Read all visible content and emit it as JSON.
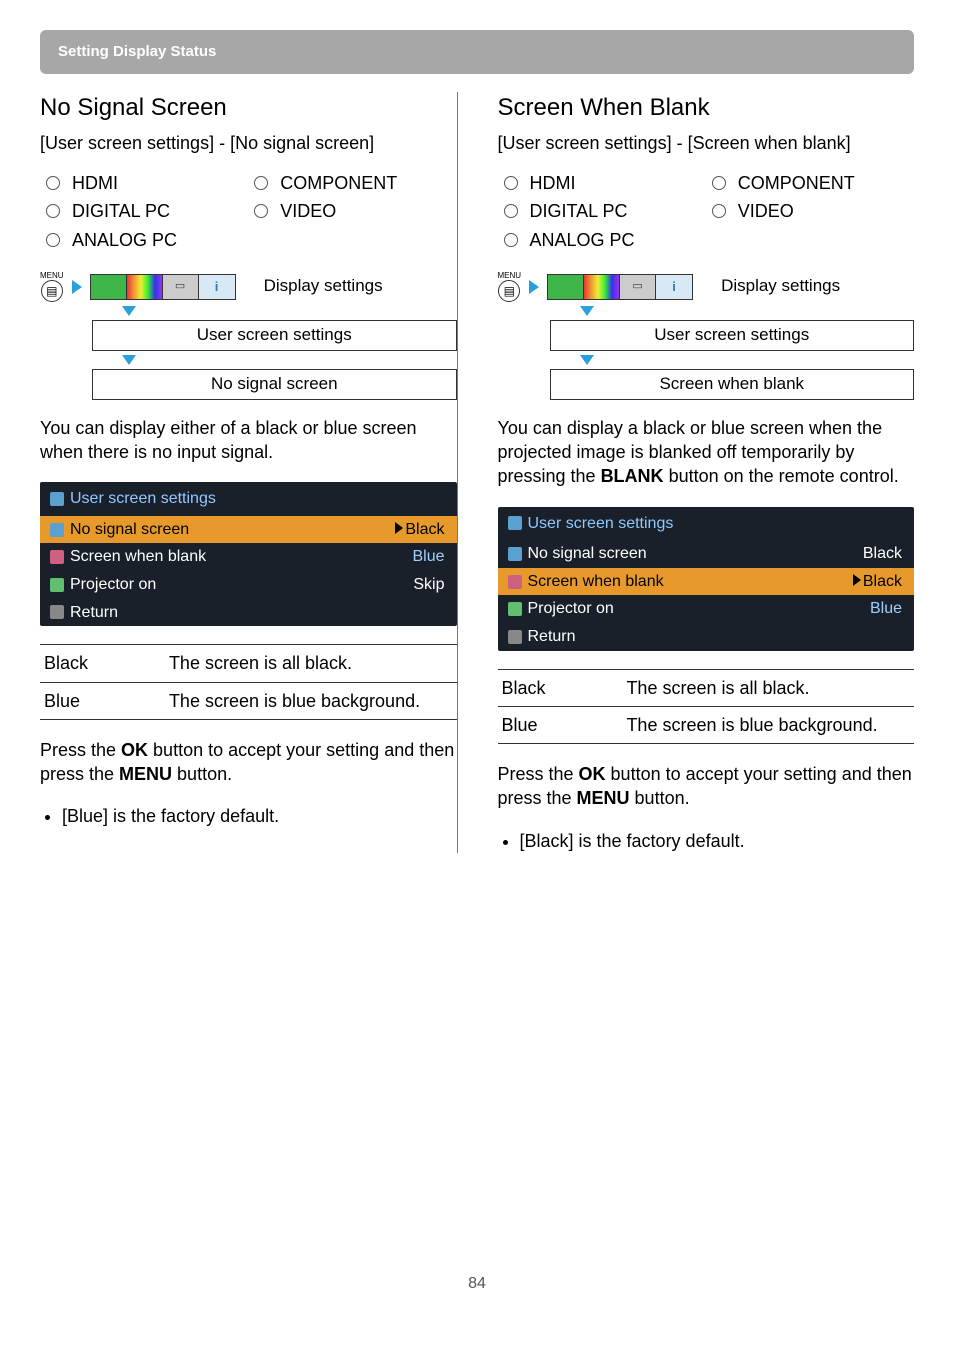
{
  "header": "Setting Display Status",
  "page_number": "84",
  "inputs": [
    "HDMI",
    "COMPONENT",
    "DIGITAL PC",
    "VIDEO",
    "ANALOG PC"
  ],
  "nav": {
    "menu_word": "MENU",
    "display_settings": "Display settings",
    "user_screen_settings": "User screen settings",
    "info_glyph": "i",
    "proj_glyph": "▭"
  },
  "left": {
    "title": "No Signal Screen",
    "breadcrumb": "[User screen settings] - [No signal screen]",
    "nav_leaf": "No signal screen",
    "desc": "You can display either of a black or blue screen when there is no input signal.",
    "osd": {
      "title": "User screen settings",
      "rows": [
        {
          "name": "No signal screen",
          "value": "Black",
          "highlight": true,
          "arrow": true,
          "value_color": "black",
          "icon": "blue"
        },
        {
          "name": "Screen when blank",
          "value": "Blue",
          "highlight": false,
          "arrow": false,
          "value_color": "blue",
          "icon": "pink"
        },
        {
          "name": "Projector on",
          "value": "Skip",
          "highlight": false,
          "arrow": false,
          "value_color": "white",
          "icon": "green"
        },
        {
          "name": "Return",
          "value": "",
          "highlight": false,
          "arrow": false,
          "value_color": "",
          "icon": "grey"
        }
      ]
    },
    "options": [
      {
        "k": "Black",
        "v": "The screen is all black."
      },
      {
        "k": "Blue",
        "v": "The screen is blue background."
      }
    ],
    "accept_pre": "Press the ",
    "accept_ok": "OK",
    "accept_mid": " button to accept your setting and then press the ",
    "accept_menu": "MENU",
    "accept_post": " button.",
    "note": "[Blue] is the factory default."
  },
  "right": {
    "title": "Screen When Blank",
    "breadcrumb": "[User screen settings] - [Screen when blank]",
    "nav_leaf": "Screen when blank",
    "desc_pre": "You can display a black or blue screen when the projected image is blanked off temporarily by pressing the ",
    "desc_kw": "BLANK",
    "desc_post": " button on the remote control.",
    "osd": {
      "title": "User screen settings",
      "rows": [
        {
          "name": "No signal screen",
          "value": "Black",
          "highlight": false,
          "arrow": false,
          "value_color": "white",
          "icon": "blue"
        },
        {
          "name": "Screen when blank",
          "value": "Black",
          "highlight": true,
          "arrow": true,
          "value_color": "black",
          "icon": "pink"
        },
        {
          "name": "Projector on",
          "value": "Blue",
          "highlight": false,
          "arrow": false,
          "value_color": "blue",
          "icon": "green"
        },
        {
          "name": "Return",
          "value": "",
          "highlight": false,
          "arrow": false,
          "value_color": "",
          "icon": "grey"
        }
      ]
    },
    "options": [
      {
        "k": "Black",
        "v": "The screen is all black."
      },
      {
        "k": "Blue",
        "v": "The screen is blue background."
      }
    ],
    "accept_pre": "Press the ",
    "accept_ok": "OK",
    "accept_mid": " button to accept your setting and then press the ",
    "accept_menu": "MENU",
    "accept_post": " button.",
    "note": "[Black] is the factory default."
  }
}
